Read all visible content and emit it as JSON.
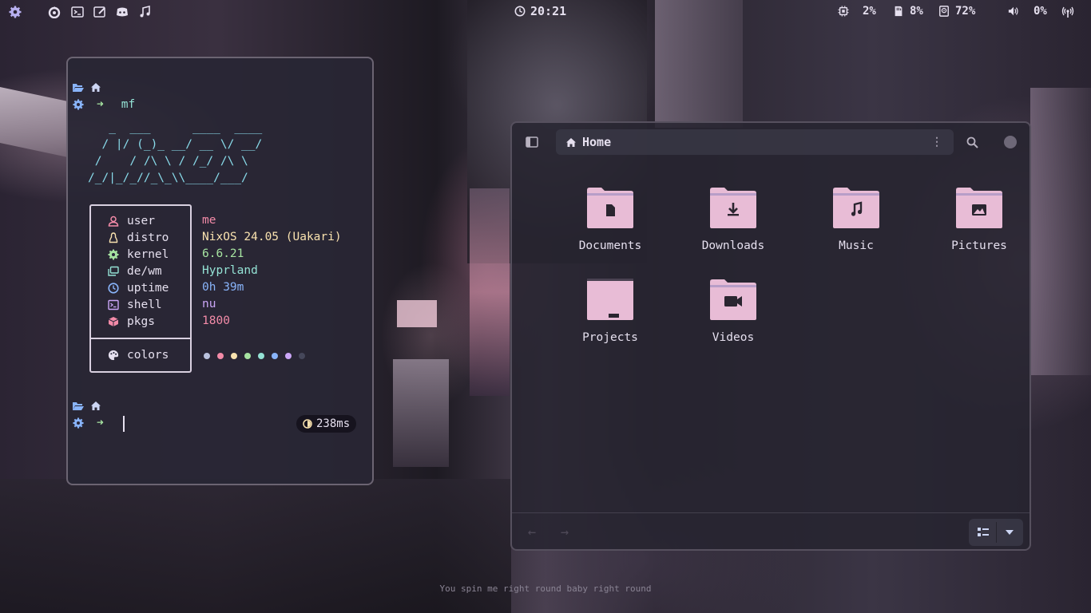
{
  "topbar": {
    "workspace_icon": "gear-icon",
    "launchers": [
      "firefox-icon",
      "terminal-icon",
      "editor-icon",
      "discord-icon",
      "music-icon"
    ],
    "clock": "20:21",
    "cpu": "2%",
    "memory": "8%",
    "disk": "72%",
    "volume": "0%"
  },
  "terminal": {
    "command": "mf",
    "ascii_art": "   _  ___      ____  ____\n  / |/ (_)_ __/ __ \\/ __/\n /    / /\\ \\ / /_/ /\\ \\  \n/_/|_/_//_\\_\\\\____/___/  ",
    "info": [
      {
        "key": "user",
        "value": "me",
        "color": "#f38ba8",
        "icon": "user-icon"
      },
      {
        "key": "distro",
        "value": "NixOS 24.05 (Uakari)",
        "color": "#f9e2af",
        "icon": "linux-icon"
      },
      {
        "key": "kernel",
        "value": "6.6.21",
        "color": "#a6e3a1",
        "icon": "gear-icon"
      },
      {
        "key": "de/wm",
        "value": "Hyprland",
        "color": "#94e2d5",
        "icon": "window-icon"
      },
      {
        "key": "uptime",
        "value": "0h 39m",
        "color": "#89b4fa",
        "icon": "clock-icon"
      },
      {
        "key": "shell",
        "value": "nu",
        "color": "#cba6f7",
        "icon": "terminal-icon"
      },
      {
        "key": "pkgs",
        "value": "1800",
        "color": "#f38ba8",
        "icon": "package-icon"
      }
    ],
    "colors_label": "colors",
    "palette": [
      "#bac2de",
      "#f38ba8",
      "#f9e2af",
      "#a6e3a1",
      "#94e2d5",
      "#89b4fa",
      "#cba6f7",
      "#45475a"
    ],
    "timing": "238ms"
  },
  "files": {
    "location": "Home",
    "folders": [
      {
        "name": "Documents",
        "icon": "document-icon"
      },
      {
        "name": "Downloads",
        "icon": "download-icon"
      },
      {
        "name": "Music",
        "icon": "music-icon"
      },
      {
        "name": "Pictures",
        "icon": "image-icon"
      },
      {
        "name": "Projects",
        "icon": "folder-icon"
      },
      {
        "name": "Videos",
        "icon": "video-icon"
      }
    ]
  },
  "wallpaper_caption": "You spin me right round baby right round"
}
